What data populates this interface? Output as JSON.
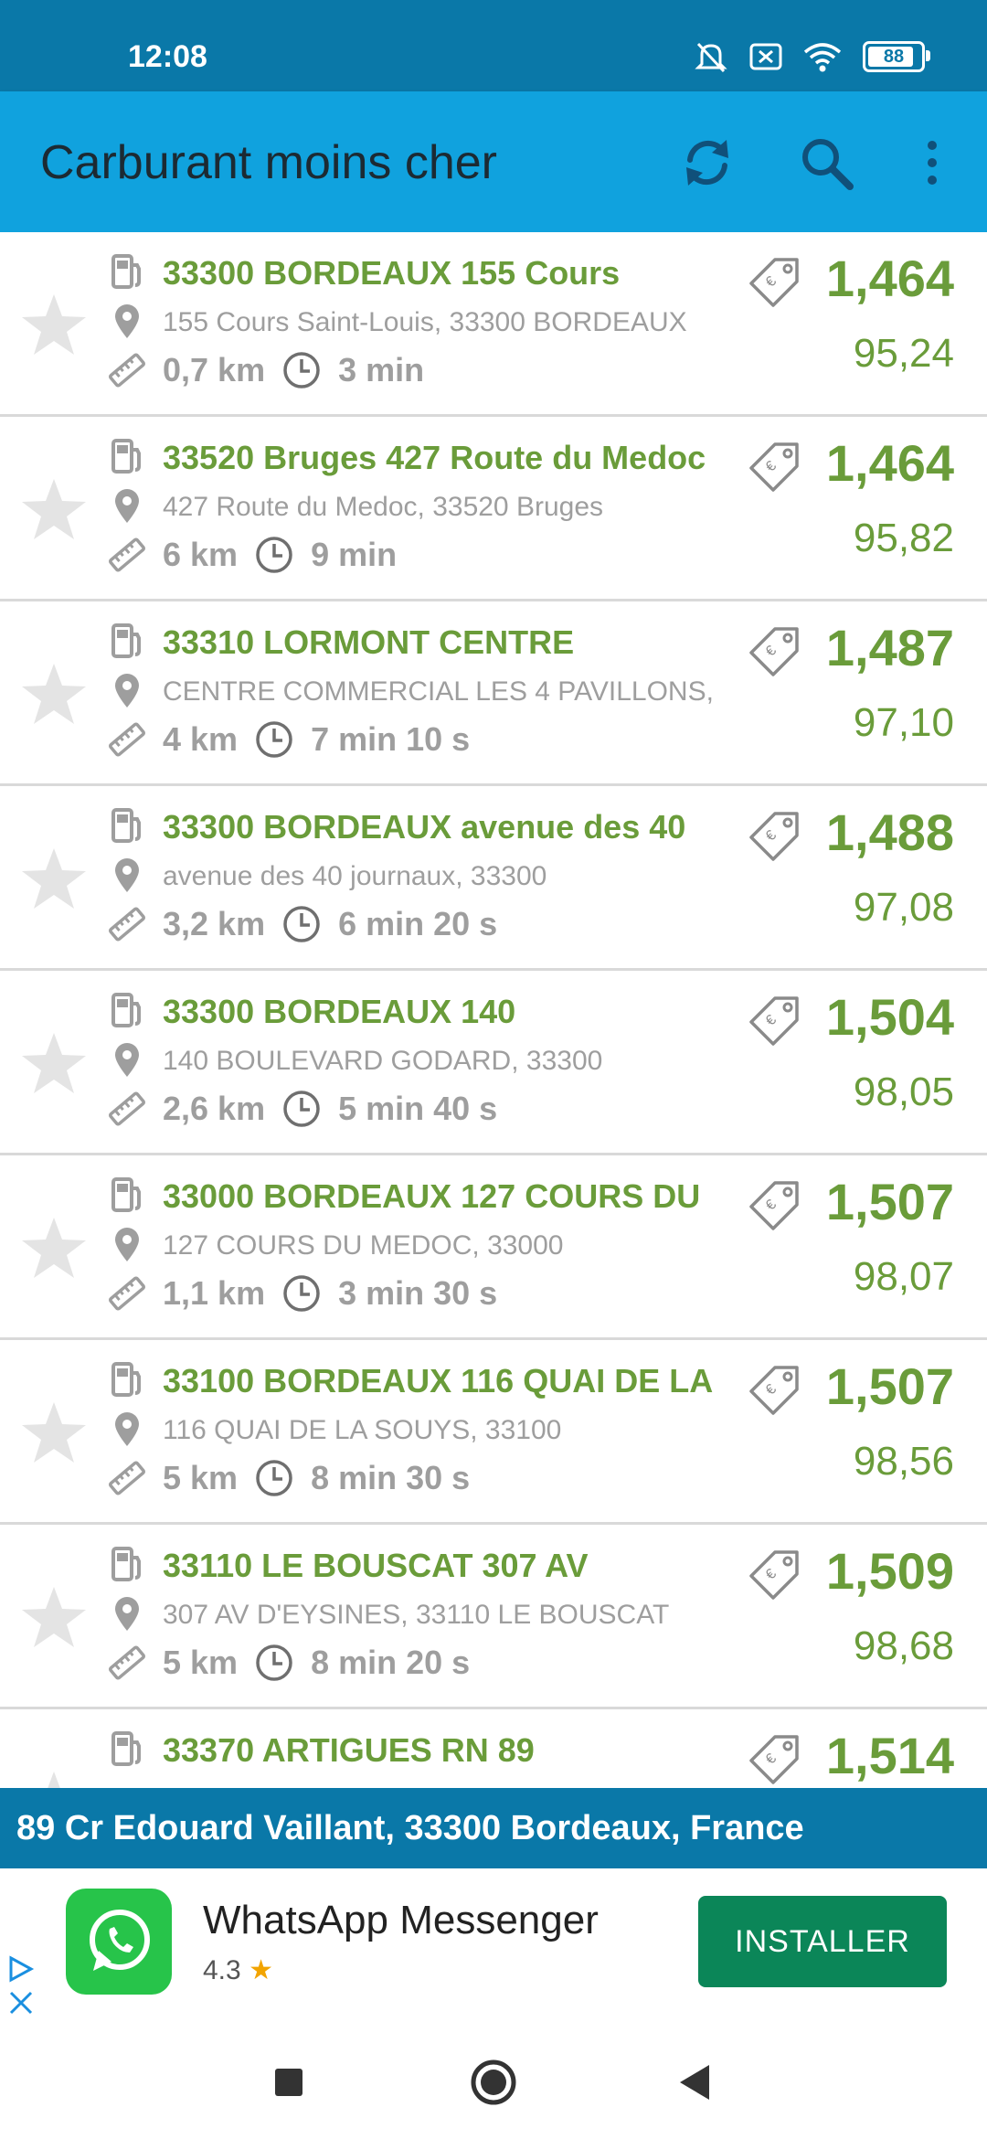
{
  "status_bar": {
    "time": "12:08",
    "battery": "88"
  },
  "app_bar": {
    "title": "Carburant moins cher"
  },
  "stations": [
    {
      "name": "33300 BORDEAUX 155 Cours",
      "address": "155 Cours Saint-Louis, 33300 BORDEAUX",
      "distance": "0,7 km",
      "duration": "3 min",
      "price": "1,464",
      "total": "95,24"
    },
    {
      "name": "33520 Bruges 427 Route du Medoc",
      "address": "427 Route du Medoc, 33520 Bruges",
      "distance": "6 km",
      "duration": "9 min",
      "price": "1,464",
      "total": "95,82"
    },
    {
      "name": "33310 LORMONT CENTRE",
      "address": "CENTRE COMMERCIAL LES 4 PAVILLONS,",
      "distance": "4 km",
      "duration": "7 min 10 s",
      "price": "1,487",
      "total": "97,10"
    },
    {
      "name": "33300 BORDEAUX avenue des 40",
      "address": "avenue des 40 journaux, 33300",
      "distance": "3,2 km",
      "duration": "6 min 20 s",
      "price": "1,488",
      "total": "97,08"
    },
    {
      "name": "33300 BORDEAUX 140",
      "address": "140 BOULEVARD GODARD, 33300",
      "distance": "2,6 km",
      "duration": "5 min 40 s",
      "price": "1,504",
      "total": "98,05"
    },
    {
      "name": "33000 BORDEAUX 127 COURS DU",
      "address": "127 COURS DU MEDOC, 33000",
      "distance": "1,1 km",
      "duration": "3 min 30 s",
      "price": "1,507",
      "total": "98,07"
    },
    {
      "name": "33100 BORDEAUX 116 QUAI DE LA",
      "address": "116 QUAI DE LA SOUYS, 33100",
      "distance": "5 km",
      "duration": "8 min 30 s",
      "price": "1,507",
      "total": "98,56"
    },
    {
      "name": "33110 LE BOUSCAT 307 AV",
      "address": "307 AV D'EYSINES, 33110 LE BOUSCAT",
      "distance": "5 km",
      "duration": "8 min 20 s",
      "price": "1,509",
      "total": "98,68"
    },
    {
      "name": "33370 ARTIGUES RN 89",
      "address": "",
      "distance": "",
      "duration": "",
      "price": "1,514",
      "total": ""
    }
  ],
  "location_bar": {
    "text": "89 Cr Edouard Vaillant, 33300 Bordeaux, France"
  },
  "ad": {
    "app_name": "WhatsApp Messenger",
    "rating": "4.3",
    "rating_star": "★",
    "install_label": "INSTALLER"
  },
  "colors": {
    "status_bar": "#0a78a8",
    "app_bar": "#10a2de",
    "price_green": "#6a9c3a",
    "install_green": "#0b8658",
    "muted_gray": "#9e9e9e"
  }
}
